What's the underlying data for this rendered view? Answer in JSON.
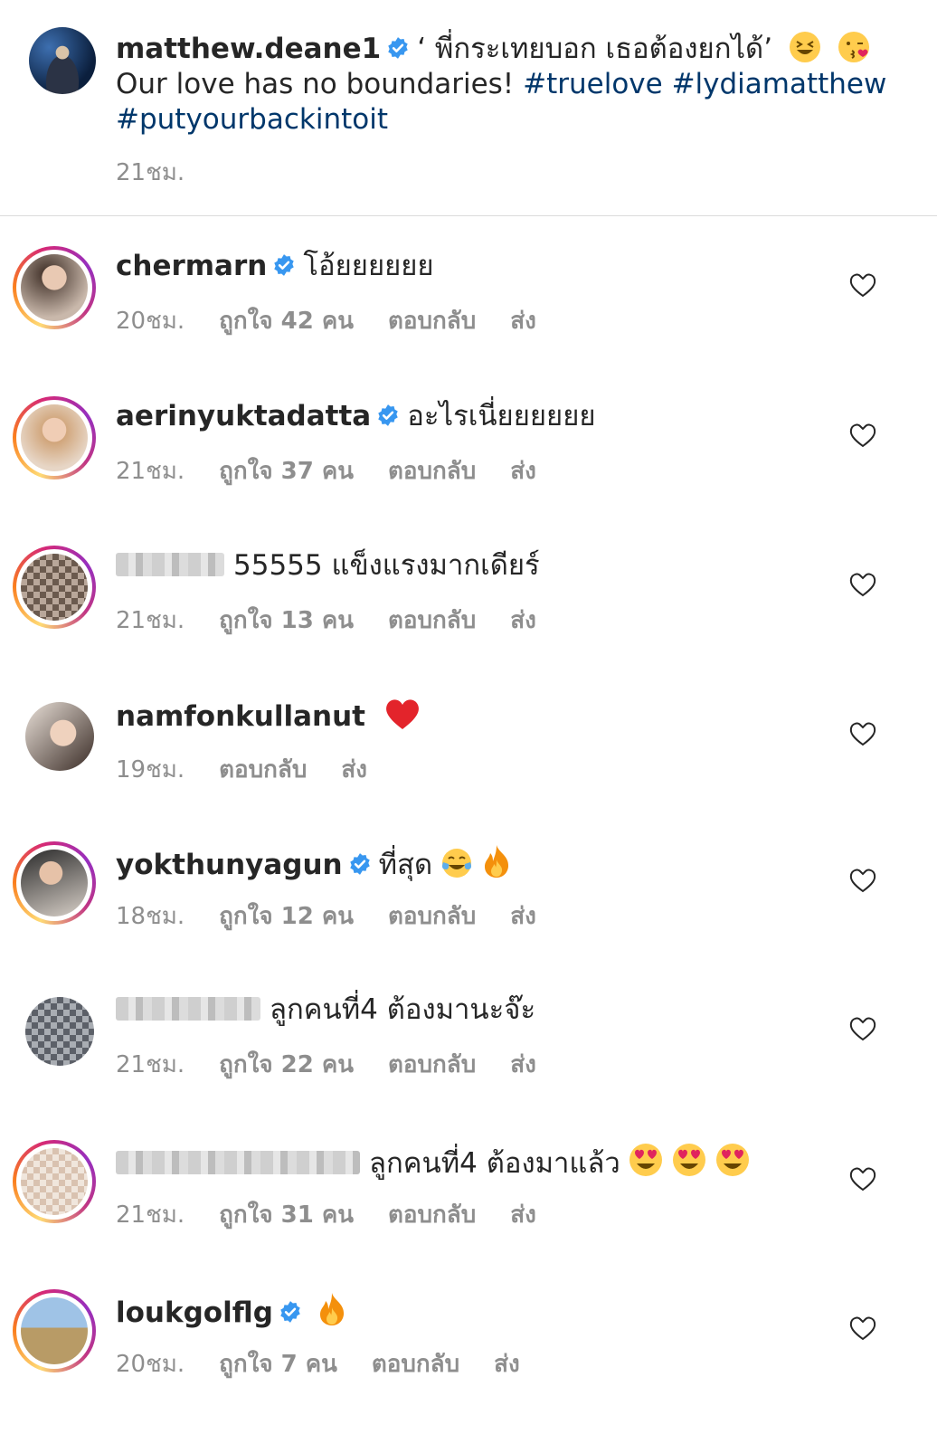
{
  "post": {
    "username": "matthew.deane1",
    "caption_thai": "‘ พี่กระเทยบอก เธอต้องยกได้’",
    "caption_en": "Our love has no boundaries!",
    "hashtags": [
      "#truelove",
      "#lydiamatthew",
      "#putyourbackintoit"
    ],
    "time": "21ชม."
  },
  "comments": [
    {
      "username": "chermarn",
      "verified": true,
      "text": "โอ้ยยยยยย",
      "time": "20ชม.",
      "likes": "ถูกใจ 42 คน",
      "reply": "ตอบกลับ",
      "send": "ส่ง",
      "ring": true
    },
    {
      "username": "aerinyuktadatta",
      "verified": true,
      "text": "อะไรเนี่ยยยยยย",
      "time": "21ชม.",
      "likes": "ถูกใจ 37 คน",
      "reply": "ตอบกลับ",
      "send": "ส่ง",
      "ring": true
    },
    {
      "username": "",
      "verified": false,
      "text": "55555 แข็งแรงมากเดียร์",
      "time": "21ชม.",
      "likes": "ถูกใจ 13 คน",
      "reply": "ตอบกลับ",
      "send": "ส่ง",
      "ring": true
    },
    {
      "username": "namfonkullanut",
      "verified": false,
      "text": "",
      "time": "19ชม.",
      "likes": "",
      "reply": "ตอบกลับ",
      "send": "ส่ง",
      "ring": false
    },
    {
      "username": "yokthunyagun",
      "verified": true,
      "text": "ที่สุด",
      "time": "18ชม.",
      "likes": "ถูกใจ 12 คน",
      "reply": "ตอบกลับ",
      "send": "ส่ง",
      "ring": true
    },
    {
      "username": "",
      "verified": false,
      "text": "ลูกคนที่4 ต้องมานะจ๊ะ",
      "time": "21ชม.",
      "likes": "ถูกใจ 22 คน",
      "reply": "ตอบกลับ",
      "send": "ส่ง",
      "ring": false
    },
    {
      "username": "",
      "verified": false,
      "text": "ลูกคนที่4 ต้องมาแล้ว",
      "time": "21ชม.",
      "likes": "ถูกใจ 31 คน",
      "reply": "ตอบกลับ",
      "send": "ส่ง",
      "ring": true
    },
    {
      "username": "loukgolflg",
      "verified": true,
      "text": "",
      "time": "20ชม.",
      "likes": "ถูกใจ 7 คน",
      "reply": "ตอบกลับ",
      "send": "ส่ง",
      "ring": true
    }
  ],
  "colors": {
    "link": "#00376b",
    "verified": "#3897f0",
    "meta": "#8e8e8e",
    "heart_red": "#ed4956"
  }
}
